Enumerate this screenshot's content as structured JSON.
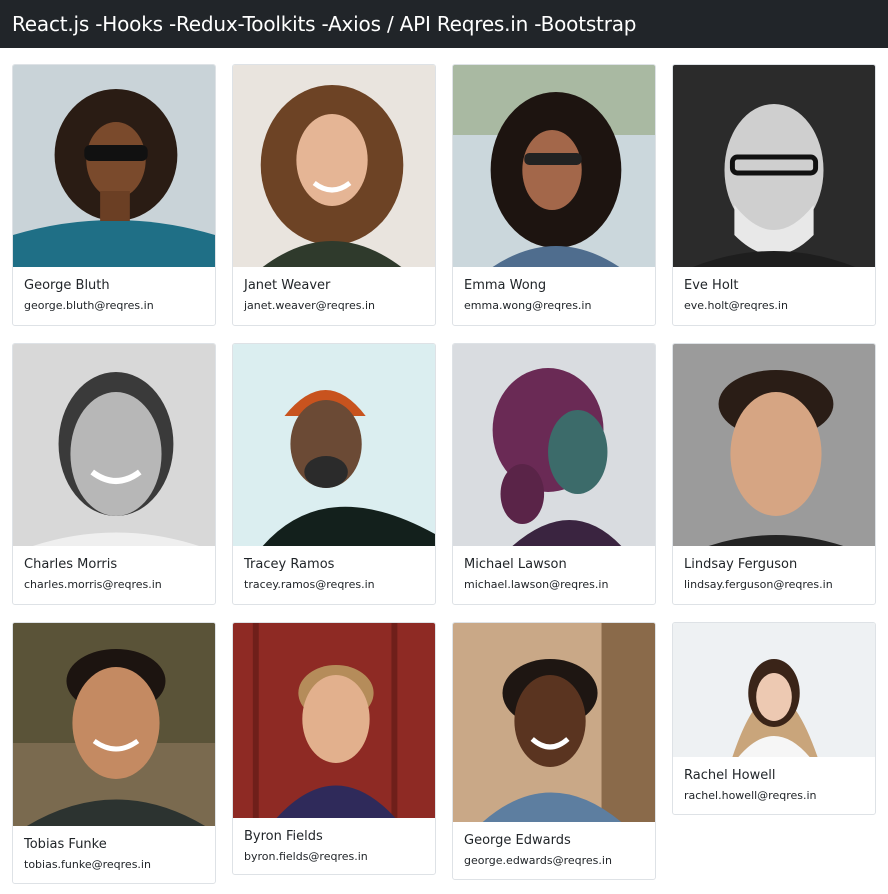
{
  "navbar": {
    "brand": "React.js -Hooks -Redux-Toolkits -Axios / API Reqres.in -Bootstrap"
  },
  "users": [
    {
      "name": "George Bluth",
      "email": "george.bluth@reqres.in"
    },
    {
      "name": "Janet Weaver",
      "email": "janet.weaver@reqres.in"
    },
    {
      "name": "Emma Wong",
      "email": "emma.wong@reqres.in"
    },
    {
      "name": "Eve Holt",
      "email": "eve.holt@reqres.in"
    },
    {
      "name": "Charles Morris",
      "email": "charles.morris@reqres.in"
    },
    {
      "name": "Tracey Ramos",
      "email": "tracey.ramos@reqres.in"
    },
    {
      "name": "Michael Lawson",
      "email": "michael.lawson@reqres.in"
    },
    {
      "name": "Lindsay Ferguson",
      "email": "lindsay.ferguson@reqres.in"
    },
    {
      "name": "Tobias Funke",
      "email": "tobias.funke@reqres.in"
    },
    {
      "name": "Byron Fields",
      "email": "byron.fields@reqres.in"
    },
    {
      "name": "George Edwards",
      "email": "george.edwards@reqres.in"
    },
    {
      "name": "Rachel Howell",
      "email": "rachel.howell@reqres.in"
    }
  ]
}
